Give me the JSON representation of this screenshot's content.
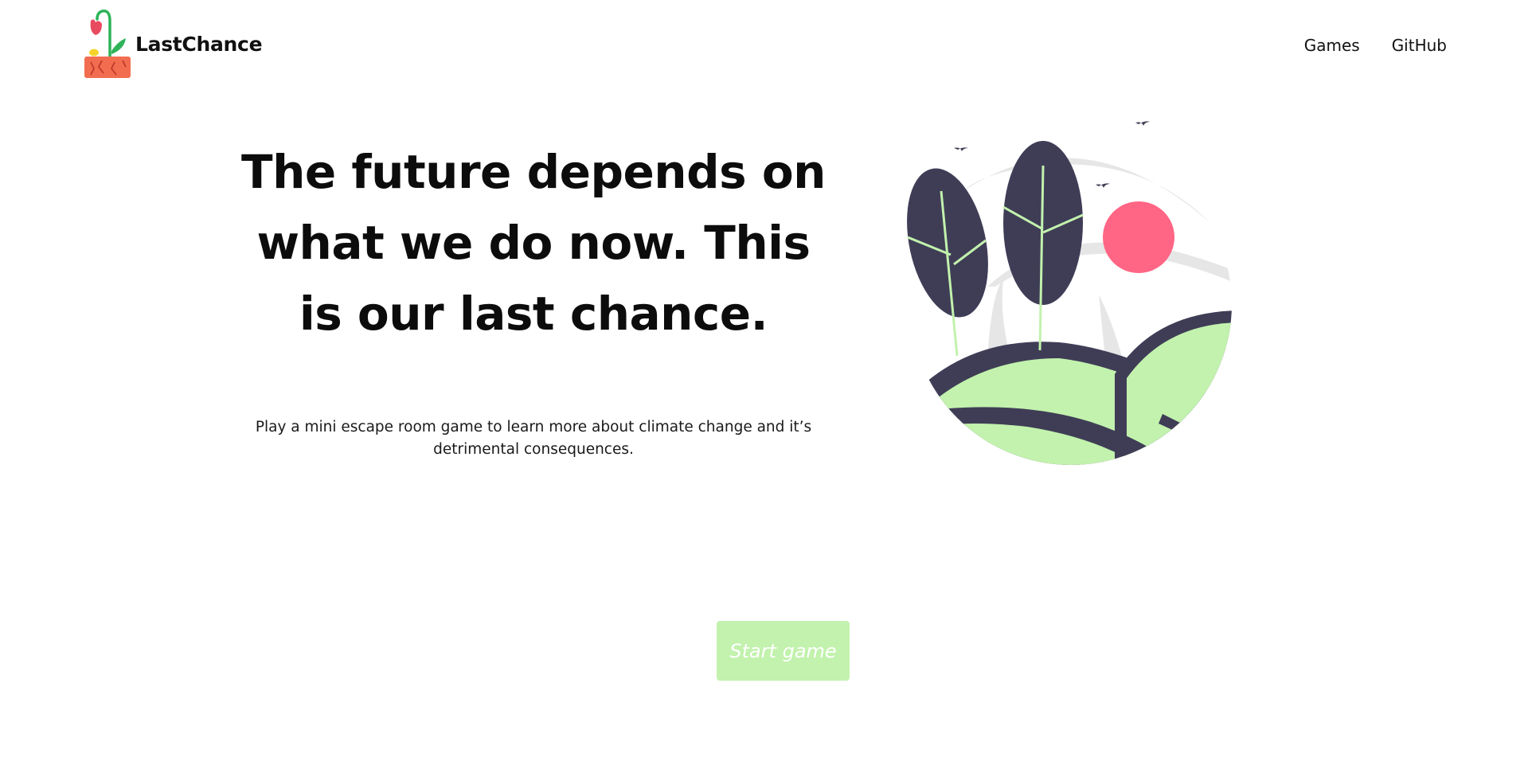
{
  "header": {
    "brand_name": "LastChance",
    "nav": [
      {
        "label": "Games"
      },
      {
        "label": "GitHub"
      }
    ]
  },
  "hero": {
    "headline": "The future depends on what we do now. This is our last chance.",
    "subtext": "Play a mini escape room game to learn more about climate change and it’s detrimental consequences.",
    "start_button_label": "Start game"
  },
  "icons": {
    "logo": "wilted-flower-in-pot-logo",
    "illustration": "trees-hills-sun-birds-illustration"
  },
  "colors": {
    "accent_green": "#c2f2ad",
    "dark_navy": "#3f3d56",
    "sun_pink": "#ff6584",
    "pot_orange": "#f26d4f",
    "grey": "#e6e6e6"
  }
}
